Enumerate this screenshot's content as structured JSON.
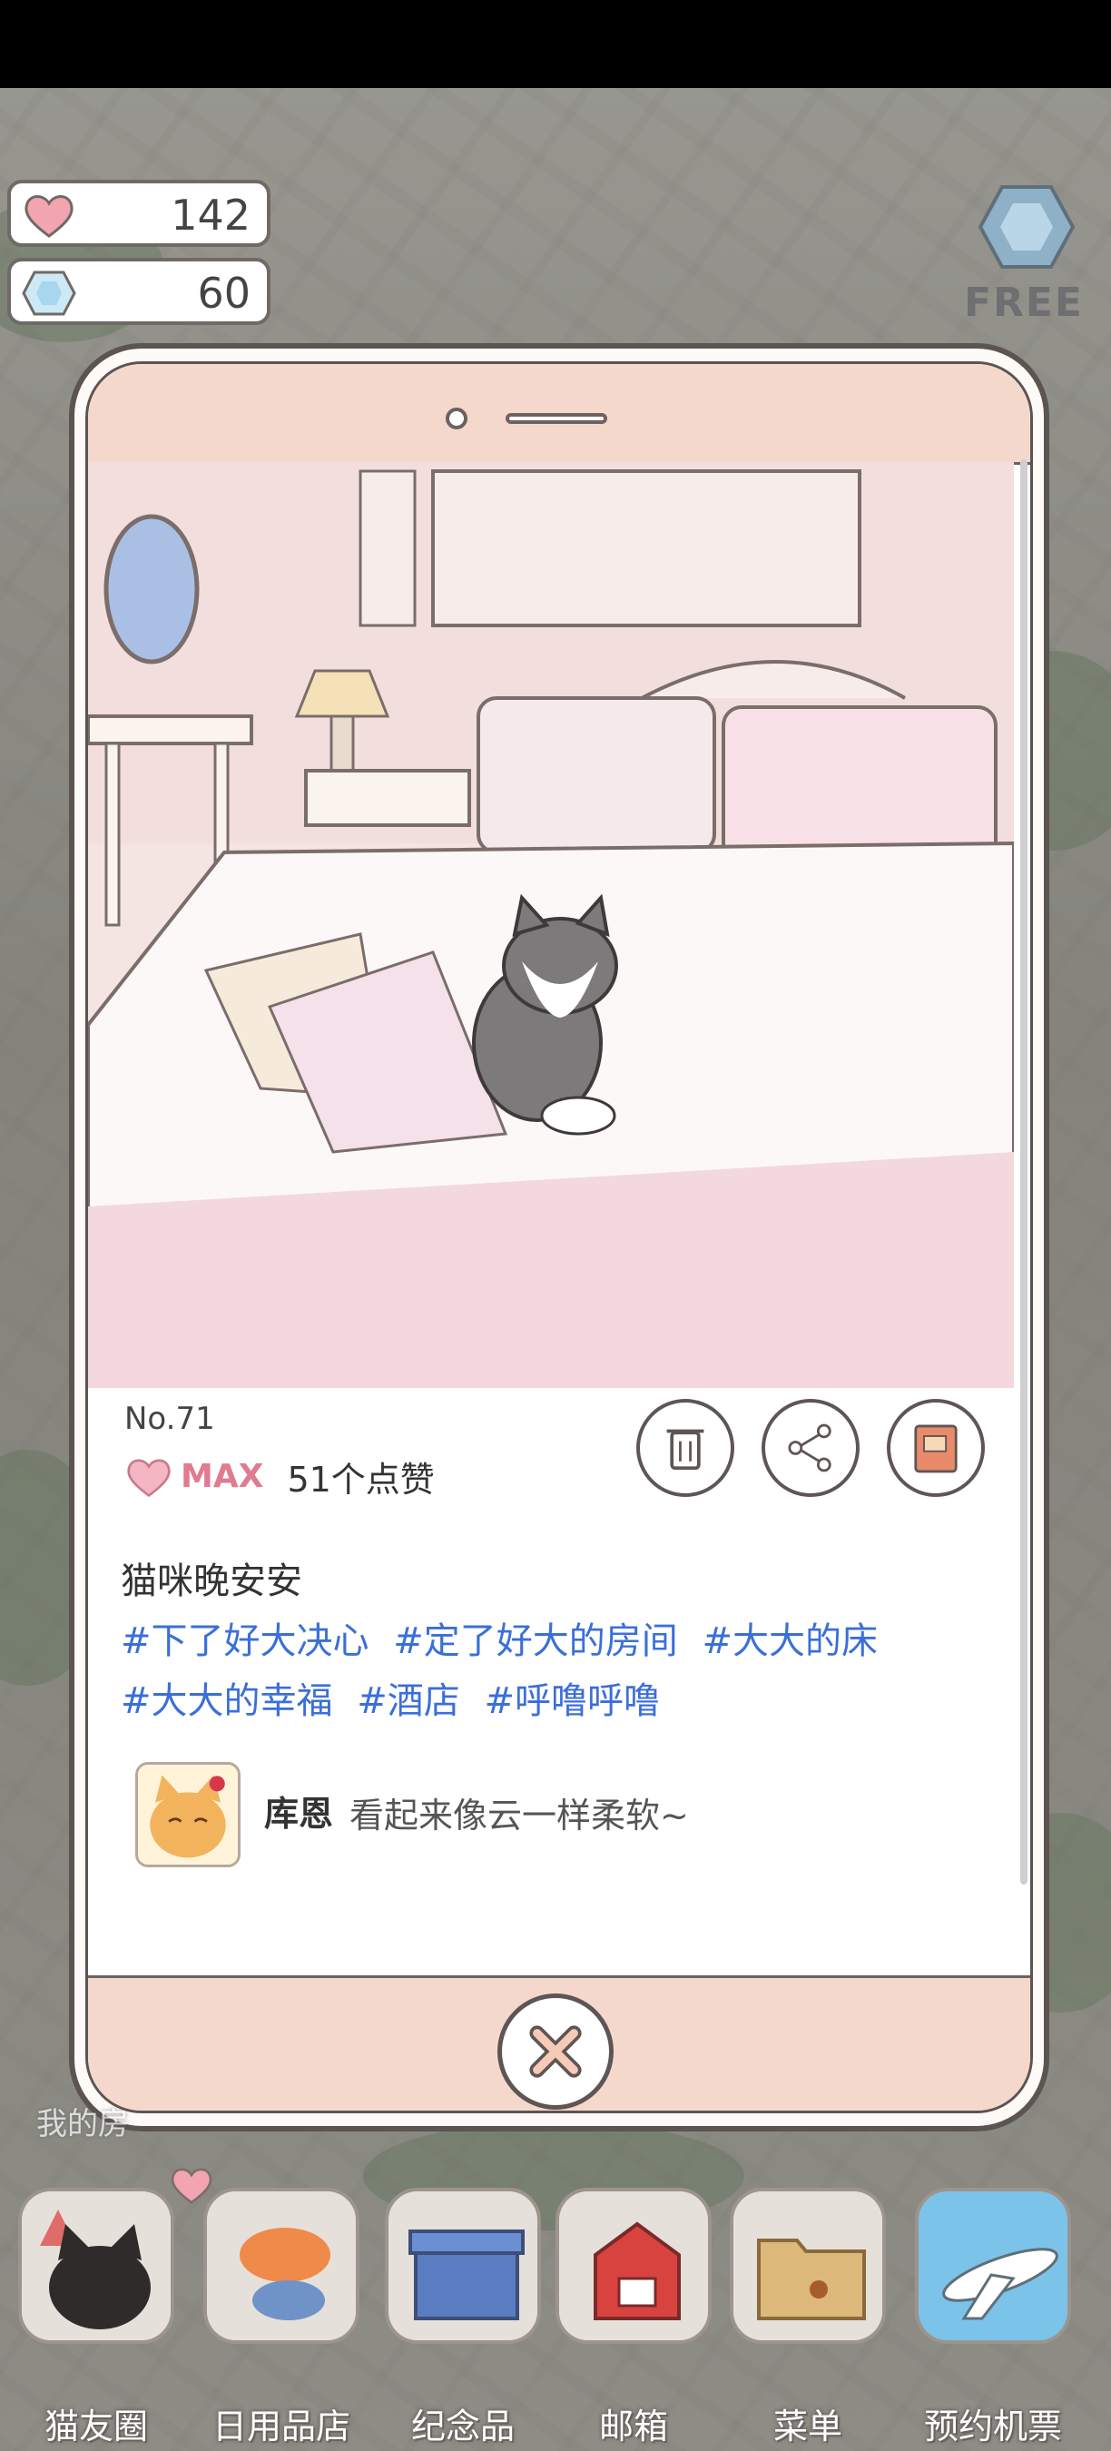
{
  "currency": {
    "hearts": "142",
    "gems": "60",
    "free_label": "FREE"
  },
  "post": {
    "number": "No.71",
    "like_level": "MAX",
    "like_count": "51个点赞",
    "caption": "猫咪晚安安",
    "hashtags": [
      "#下了好大决心",
      "#定了好大的房间",
      "#大大的床",
      "#大大的幸福",
      "#酒店",
      "#呼噜呼噜"
    ],
    "comment": {
      "author": "库恩",
      "text": "看起来像云一样柔软~"
    },
    "actions": [
      "trash-icon",
      "share-icon",
      "book-icon"
    ]
  },
  "dock": {
    "partial_label": "我的房",
    "items": [
      {
        "label": "猫友圈",
        "icon": "cat-photo-icon"
      },
      {
        "label": "日用品店",
        "icon": "shop-icon"
      },
      {
        "label": "纪念品",
        "icon": "box-icon"
      },
      {
        "label": "邮箱",
        "icon": "mailbox-icon"
      },
      {
        "label": "菜单",
        "icon": "folder-icon"
      },
      {
        "label": "预约机票",
        "icon": "airplane-icon"
      }
    ]
  },
  "colors": {
    "accent_pink": "#f5d8cc",
    "hashtag_blue": "#3b6fd8",
    "max_pink": "#e07b90"
  }
}
